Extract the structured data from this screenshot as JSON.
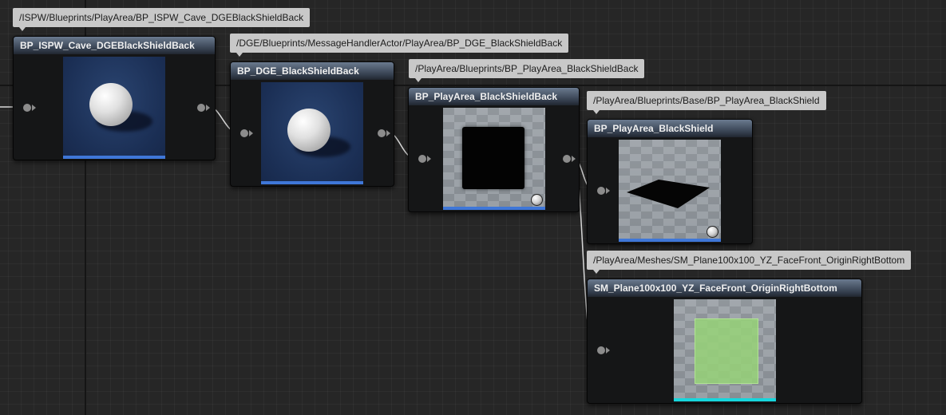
{
  "nodes": [
    {
      "id": "n1",
      "path": "/ISPW/Blueprints/PlayArea/BP_ISPW_Cave_DGEBlackShieldBack",
      "title": "BP_ISPW_Cave_DGEBlackShieldBack",
      "thumbnail": "sphere",
      "thumbnail_bar_color": "#3f77d8"
    },
    {
      "id": "n2",
      "path": "/DGE/Blueprints/MessageHandlerActor/PlayArea/BP_DGE_BlackShieldBack",
      "title": "BP_DGE_BlackShieldBack",
      "thumbnail": "sphere",
      "thumbnail_bar_color": "#3f77d8"
    },
    {
      "id": "n3",
      "path": "/PlayArea/Blueprints/BP_PlayArea_BlackShieldBack",
      "title": "BP_PlayArea_BlackShieldBack",
      "thumbnail": "black-square",
      "thumbnail_bar_color": "#3f77d8"
    },
    {
      "id": "n4",
      "path": "/PlayArea/Blueprints/Base/BP_PlayArea_BlackShield",
      "title": "BP_PlayArea_BlackShield",
      "thumbnail": "black-plane",
      "thumbnail_bar_color": "#3f77d8"
    },
    {
      "id": "n5",
      "path": "/PlayArea/Meshes/SM_Plane100x100_YZ_FaceFront_OriginRightBottom",
      "title": "SM_Plane100x100_YZ_FaceFront_OriginRightBottom",
      "thumbnail": "green-plane",
      "thumbnail_bar_color": "#17d6dc"
    }
  ],
  "colors": {
    "graph_background": "#262626",
    "node_header": "#4a586b",
    "tooltip_background": "#c8c8c8",
    "wire": "#d8d8d8",
    "pin": "#8c8c8c"
  }
}
